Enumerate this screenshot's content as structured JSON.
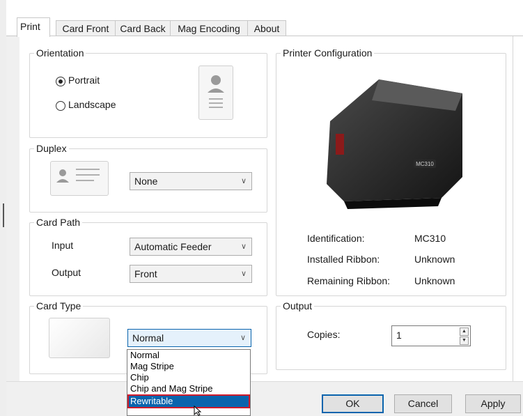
{
  "tabs": [
    {
      "label": "Print",
      "active": true
    },
    {
      "label": "Card Front"
    },
    {
      "label": "Card Back"
    },
    {
      "label": "Mag Encoding"
    },
    {
      "label": "About"
    }
  ],
  "orientation": {
    "title": "Orientation",
    "options": [
      "Portrait",
      "Landscape"
    ],
    "selected": "Portrait"
  },
  "duplex": {
    "title": "Duplex",
    "value": "None"
  },
  "card_path": {
    "title": "Card Path",
    "input_label": "Input",
    "input_value": "Automatic Feeder",
    "output_label": "Output",
    "output_value": "Front"
  },
  "card_type": {
    "title": "Card Type",
    "value": "Normal",
    "options": [
      "Normal",
      "Mag Stripe",
      "Chip",
      "Chip and Mag Stripe",
      "Rewritable"
    ],
    "highlighted": "Rewritable"
  },
  "printer_config": {
    "title": "Printer Configuration",
    "printer_badge": "MC310",
    "rows": [
      {
        "label": "Identification:",
        "value": "MC310"
      },
      {
        "label": "Installed Ribbon:",
        "value": "Unknown"
      },
      {
        "label": "Remaining Ribbon:",
        "value": "Unknown"
      }
    ]
  },
  "output": {
    "title": "Output",
    "copies_label": "Copies:",
    "copies_value": "1"
  },
  "buttons": {
    "ok": "OK",
    "cancel": "Cancel",
    "apply": "Apply"
  },
  "colors": {
    "accent": "#0a64ad",
    "highlight_border": "#d11a2a"
  }
}
